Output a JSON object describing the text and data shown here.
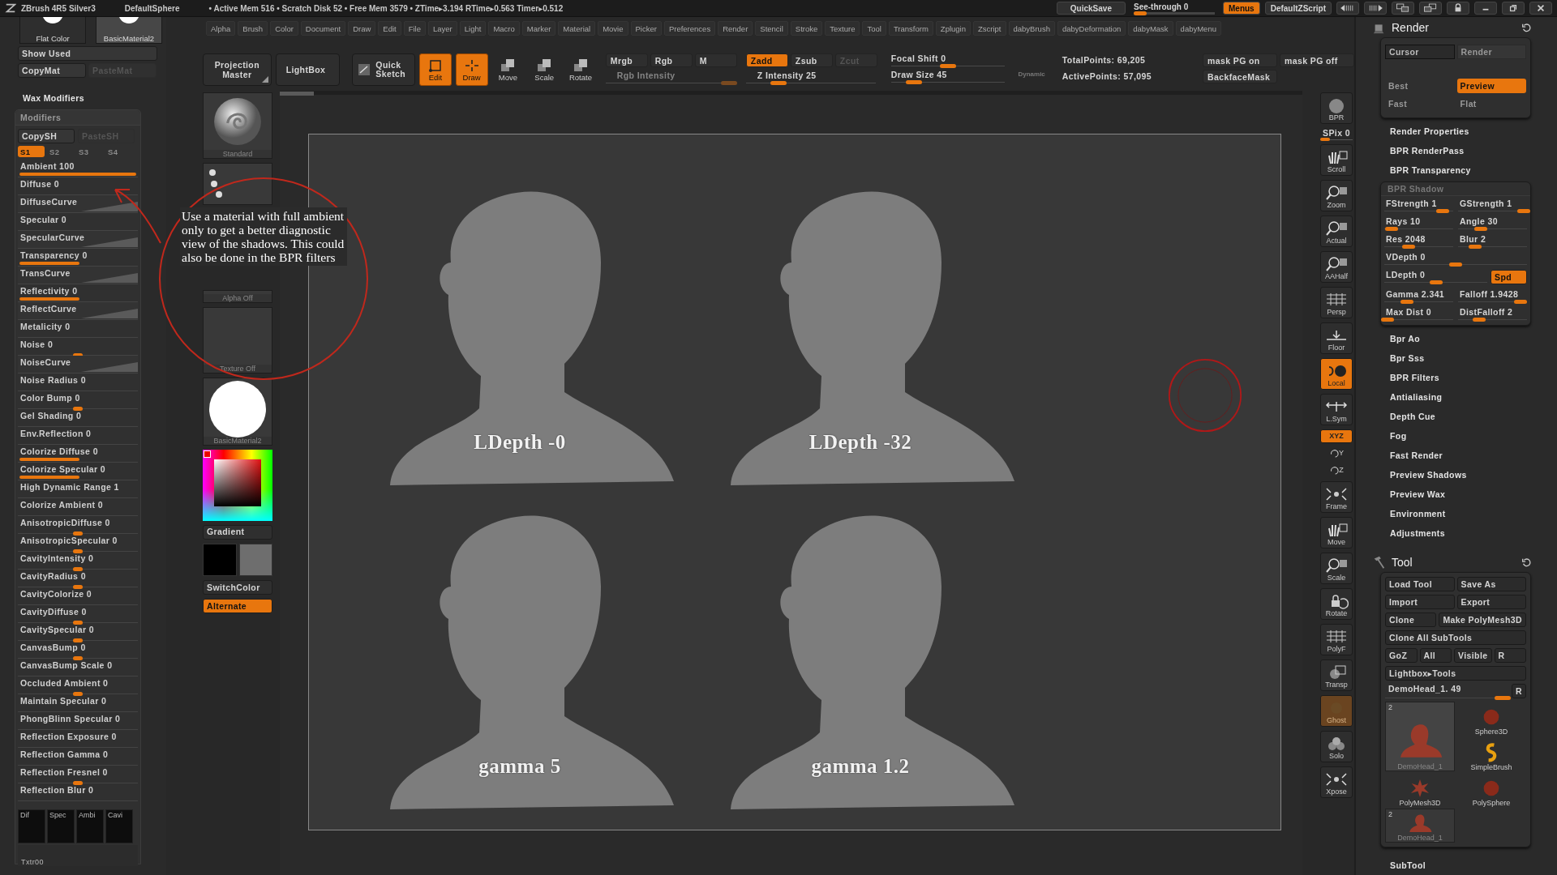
{
  "title_bar": {
    "app": "ZBrush 4R5 Silver3",
    "document": "DefaultSphere",
    "stats": "• Active Mem 516 • Scratch Disk 52 • Free Mem 3579 • ZTime▸3.194 RTime▸0.563 Timer▸0.512",
    "quicksave": "QuickSave",
    "see_through": {
      "label": "See-through 0",
      "level": 0.0
    },
    "menus": {
      "label": "Menus",
      "on": true
    },
    "script": "DefaultZScript"
  },
  "menu_bar": [
    "Alpha",
    "Brush",
    "Color",
    "Document",
    "Draw",
    "Edit",
    "File",
    "Layer",
    "Light",
    "Macro",
    "Marker",
    "Material",
    "Movie",
    "Picker",
    "Preferences",
    "Render",
    "Stencil",
    "Stroke",
    "Texture",
    "Tool",
    "Transform",
    "Zplugin",
    "Zscript",
    "dabyBrush",
    "dabyDeformation",
    "dabyMask",
    "dabyMenu"
  ],
  "material_panel": {
    "thumbs": [
      "Flat Color",
      "BasicMaterial2"
    ],
    "buttons": [
      {
        "label": "Show Used",
        "disabled": false
      },
      {
        "label": "CopyMat",
        "disabled": false
      },
      {
        "label": "PasteMat",
        "disabled": true
      }
    ]
  },
  "shelf": {
    "big_buttons": [
      "Projection Master",
      "LightBox",
      "Quick Sketch"
    ],
    "modes": [
      {
        "label": "Edit",
        "on": true
      },
      {
        "label": "Draw",
        "on": true
      },
      {
        "label": "Move",
        "on": false
      },
      {
        "label": "Scale",
        "on": false
      },
      {
        "label": "Rotate",
        "on": false
      }
    ],
    "color_modes": [
      {
        "label": "Mrgb",
        "selected": false
      },
      {
        "label": "Rgb",
        "selected": false
      },
      {
        "label": "M",
        "selected": false
      }
    ],
    "rgb_intensity": {
      "label": "Rgb Intensity",
      "disabled": true,
      "level": 0.95
    },
    "z_modes": [
      {
        "label": "Zadd",
        "selected": true,
        "disabled": false
      },
      {
        "label": "Zsub",
        "selected": false,
        "disabled": false
      },
      {
        "label": "Zcut",
        "selected": false,
        "disabled": true
      }
    ],
    "z_intensity": {
      "label": "Z Intensity 25",
      "level": 0.25
    },
    "focal_shift": {
      "label": "Focal Shift 0",
      "level": 0.5
    },
    "draw_size": {
      "label": "Draw Size 45",
      "level": 0.2
    },
    "dynamic": "Dynamic",
    "total_points": "TotalPoints: 69,205",
    "active_points": "ActivePoints: 57,095",
    "mask_buttons": [
      "mask PG on",
      "mask PG off",
      "BackfaceMask"
    ]
  },
  "wax_modifiers": {
    "title": "Wax Modifiers",
    "panel_title": "Modifiers",
    "copy_buttons": [
      {
        "label": "CopySH",
        "disabled": false
      },
      {
        "label": "PasteSH",
        "disabled": true
      }
    ],
    "shaders": [
      {
        "label": "S1",
        "selected": true
      },
      {
        "label": "S2",
        "selected": false
      },
      {
        "label": "S3",
        "selected": false
      },
      {
        "label": "S4",
        "selected": false
      }
    ],
    "rows": [
      {
        "kind": "fill",
        "label": "Ambient 100",
        "level": 1
      },
      {
        "kind": "plain",
        "label": "Diffuse 0"
      },
      {
        "kind": "curve",
        "label": "DiffuseCurve"
      },
      {
        "kind": "plain",
        "label": "Specular 0"
      },
      {
        "kind": "curve",
        "label": "SpecularCurve"
      },
      {
        "kind": "fill",
        "label": "Transparency 0",
        "level": 0.5
      },
      {
        "kind": "curve",
        "label": "TransCurve"
      },
      {
        "kind": "fill",
        "label": "Reflectivity 0",
        "level": 0.5
      },
      {
        "kind": "curve",
        "label": "ReflectCurve"
      },
      {
        "kind": "plain",
        "label": "Metalicity 0"
      },
      {
        "kind": "thumb",
        "label": "Noise 0",
        "level": 0.5
      },
      {
        "kind": "curve",
        "label": "NoiseCurve"
      },
      {
        "kind": "plain",
        "label": "Noise Radius 0"
      },
      {
        "kind": "thumb",
        "label": "Color Bump 0",
        "level": 0.5
      },
      {
        "kind": "plain",
        "label": "Gel Shading 0"
      },
      {
        "kind": "plain",
        "label": "Env.Reflection 0"
      },
      {
        "kind": "fill",
        "label": "Colorize Diffuse 0",
        "level": 0.5
      },
      {
        "kind": "fill",
        "label": "Colorize Specular 0",
        "level": 0.5
      },
      {
        "kind": "plain",
        "label": "High Dynamic Range 1"
      },
      {
        "kind": "plain",
        "label": "Colorize Ambient 0"
      },
      {
        "kind": "thumb",
        "label": "AnisotropicDiffuse 0",
        "level": 0.5
      },
      {
        "kind": "thumb",
        "label": "AnisotropicSpecular 0",
        "level": 0.5
      },
      {
        "kind": "thumb",
        "label": "CavityIntensity 0",
        "level": 0.5
      },
      {
        "kind": "thumb",
        "label": "CavityRadius 0",
        "level": 0.5
      },
      {
        "kind": "plain",
        "label": "CavityColorize 0"
      },
      {
        "kind": "thumb",
        "label": "CavityDiffuse 0",
        "level": 0.5
      },
      {
        "kind": "thumb",
        "label": "CavitySpecular 0",
        "level": 0.5
      },
      {
        "kind": "thumb",
        "label": "CanvasBump 0",
        "level": 0.5
      },
      {
        "kind": "plain",
        "label": "CanvasBump Scale 0"
      },
      {
        "kind": "thumb",
        "label": "Occluded  Ambient 0",
        "level": 0.5
      },
      {
        "kind": "plain",
        "label": "Maintain Specular 0"
      },
      {
        "kind": "plain",
        "label": "PhongBlinn Specular 0"
      },
      {
        "kind": "plain",
        "label": "Reflection Exposure 0"
      },
      {
        "kind": "plain",
        "label": "Reflection Gamma 0"
      },
      {
        "kind": "thumb",
        "label": "Reflection Fresnel 0",
        "level": 0.5
      },
      {
        "kind": "plain",
        "label": "Reflection Blur 0"
      }
    ],
    "swatches": [
      "Dif",
      "Spec",
      "Ambi",
      "Cavi"
    ],
    "texture": "Txtr00"
  },
  "tool_column": {
    "brush": "Standard",
    "alpha": "Alpha Off",
    "texture": "Texture Off",
    "material": "BasicMaterial2",
    "gradient": "Gradient",
    "switch_color": "SwitchColor",
    "alternate": {
      "label": "Alternate",
      "on": true
    }
  },
  "canvas": {
    "renders": [
      {
        "caption": "LDepth -0"
      },
      {
        "caption": "LDepth -32"
      },
      {
        "caption": "gamma 5"
      },
      {
        "caption": "gamma 1.2"
      }
    ],
    "annotation": "Use a material with full ambient only to get a better diagnostic view of the shadows. This could also be done in the BPR filters"
  },
  "right_shelf": [
    {
      "kind": "big",
      "label": "BPR",
      "on": false,
      "disabled": false
    },
    {
      "kind": "slider",
      "label": "SPix 0",
      "level": 0.3
    },
    {
      "kind": "big",
      "label": "Scroll",
      "on": false,
      "disabled": false
    },
    {
      "kind": "big",
      "label": "Zoom",
      "on": false,
      "disabled": false
    },
    {
      "kind": "big",
      "label": "Actual",
      "on": false,
      "disabled": false
    },
    {
      "kind": "big",
      "label": "AAHalf",
      "on": false,
      "disabled": false
    },
    {
      "kind": "big",
      "label": "Persp",
      "on": false,
      "disabled": false
    },
    {
      "kind": "big",
      "label": "Floor",
      "on": false,
      "disabled": false
    },
    {
      "kind": "big",
      "label": "Local",
      "on": true,
      "disabled": false
    },
    {
      "kind": "big",
      "label": "L.Sym",
      "on": false,
      "disabled": false
    },
    {
      "kind": "small",
      "label": "XYZ",
      "on": true,
      "disabled": false
    },
    {
      "kind": "mini",
      "label": "Y",
      "on": false,
      "disabled": false
    },
    {
      "kind": "mini",
      "label": "Z",
      "on": false,
      "disabled": false
    },
    {
      "kind": "big",
      "label": "Frame",
      "on": false,
      "disabled": false
    },
    {
      "kind": "big",
      "label": "Move",
      "on": false,
      "disabled": false
    },
    {
      "kind": "big",
      "label": "Scale",
      "on": false,
      "disabled": false
    },
    {
      "kind": "big",
      "label": "Rotate",
      "on": false,
      "disabled": false
    },
    {
      "kind": "big",
      "label": "PolyF",
      "on": false,
      "disabled": false
    },
    {
      "kind": "big",
      "label": "Transp",
      "on": false,
      "disabled": false
    },
    {
      "kind": "big",
      "label": "Ghost",
      "on": true,
      "disabled": true
    },
    {
      "kind": "big",
      "label": "Solo",
      "on": false,
      "disabled": false
    },
    {
      "kind": "big",
      "label": "Xpose",
      "on": false,
      "disabled": false
    }
  ],
  "render_palette": {
    "title": "Render",
    "modes": [
      {
        "label": "Cursor",
        "selected": true
      },
      {
        "label": "Render",
        "selected": false
      }
    ],
    "quality": [
      {
        "label": "Best",
        "selected": false
      },
      {
        "label": "Preview",
        "selected": true
      },
      {
        "label": "Fast",
        "selected": false
      },
      {
        "label": "Flat",
        "selected": false
      }
    ],
    "sections_top": [
      "Render Properties",
      "BPR RenderPass",
      "BPR Transparency"
    ],
    "shadow": {
      "title": "BPR Shadow",
      "sliders": [
        {
          "kind": "half",
          "label": "FStrength 1",
          "level": 0.85
        },
        {
          "kind": "half",
          "label": "GStrength 1",
          "level": 0.95
        },
        {
          "kind": "half",
          "label": "Rays 10",
          "level": 0.1
        },
        {
          "kind": "half",
          "label": "Angle 30",
          "level": 0.33
        },
        {
          "kind": "half",
          "label": "Res 2048",
          "level": 0.35
        },
        {
          "kind": "half",
          "label": "Blur 2",
          "level": 0.25
        },
        {
          "kind": "wide",
          "label": "VDepth 0",
          "level": 0.5
        },
        {
          "kind": "wide",
          "label": "LDepth 0",
          "level": 0.5,
          "button": {
            "label": "Spd",
            "on": true
          }
        },
        {
          "kind": "half",
          "label": "Gamma 2.341",
          "level": 0.33
        },
        {
          "kind": "half",
          "label": "Falloff 1.9428",
          "level": 0.9
        },
        {
          "kind": "half",
          "label": "Max Dist 0",
          "level": 0.05
        },
        {
          "kind": "half",
          "label": "DistFalloff 2",
          "level": 0.3
        }
      ]
    },
    "sections_bottom": [
      "Bpr Ao",
      "Bpr Sss",
      "BPR Filters",
      "Antialiasing",
      "Depth Cue",
      "Fog",
      "Fast Render",
      "Preview Shadows",
      "Preview Wax",
      "Environment",
      "Adjustments"
    ]
  },
  "tool_palette": {
    "title": "Tool",
    "button_rows": [
      [
        "Load Tool",
        "Save As"
      ],
      [
        "Import",
        "Export"
      ],
      [
        "Clone",
        "Make PolyMesh3D"
      ],
      [
        "Clone All SubTools"
      ],
      [
        "GoZ",
        "All",
        "Visible",
        "R"
      ],
      [
        "Lightbox▸Tools"
      ]
    ],
    "current": {
      "label": "DemoHead_1. 49",
      "level": 0.95,
      "button": "R"
    },
    "tools": [
      {
        "label": "DemoHead_1",
        "count": "2",
        "selected": true
      },
      {
        "label": "Sphere3D",
        "selected": false
      },
      {
        "label": "SimpleBrush",
        "selected": false
      },
      {
        "label": "PolyMesh3D",
        "selected": false
      },
      {
        "label": "PolySphere",
        "selected": false
      },
      {
        "label": "DemoHead_1",
        "count": "2",
        "selected": false
      }
    ],
    "subtool": "SubTool"
  }
}
